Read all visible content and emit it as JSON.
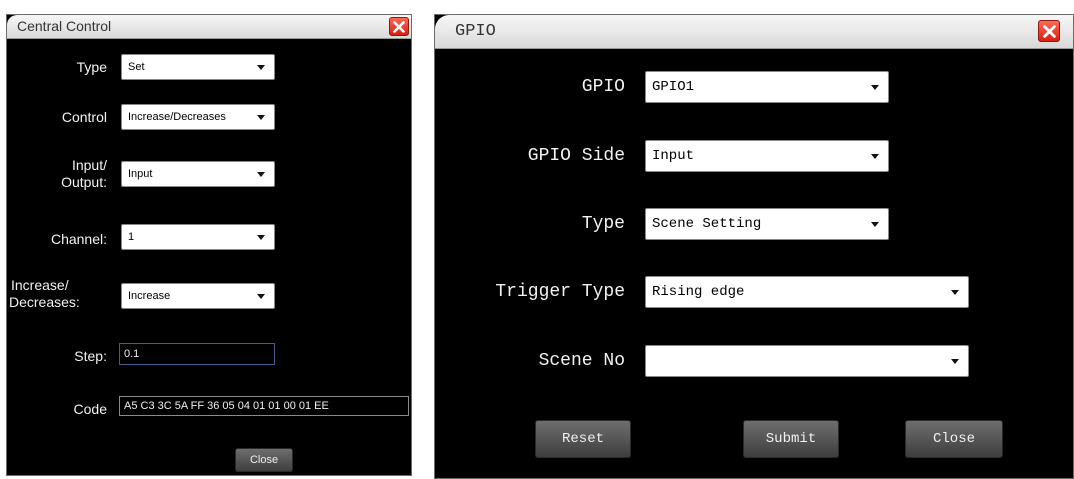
{
  "central_control": {
    "title": "Central Control",
    "type": {
      "label": "Type",
      "value": "Set"
    },
    "control": {
      "label": "Control",
      "value": "Increase/Decreases"
    },
    "input_output": {
      "label_line1": "Input/",
      "label_line2": "Output:",
      "value": "Input"
    },
    "channel": {
      "label": "Channel:",
      "value": "1"
    },
    "increase_decreases": {
      "label_line1": "Increase/",
      "label_line2": "Decreases:",
      "value": "Increase"
    },
    "step": {
      "label": "Step:",
      "value": "0.1"
    },
    "code": {
      "label": "Code",
      "value": "A5 C3 3C 5A FF 36 05 04 01 01 00 01 EE"
    },
    "close_label": "Close"
  },
  "gpio": {
    "title": "GPIO",
    "gpio": {
      "label": "GPIO",
      "value": "GPIO1"
    },
    "gpio_side": {
      "label": "GPIO Side",
      "value": "Input"
    },
    "type": {
      "label": "Type",
      "value": "Scene Setting"
    },
    "trigger_type": {
      "label": "Trigger Type",
      "value": "Rising edge"
    },
    "scene_no": {
      "label": "Scene No",
      "value": ""
    },
    "reset_label": "Reset",
    "submit_label": "Submit",
    "close_label": "Close"
  },
  "colors": {
    "close_x": "#e0301e",
    "dialog_bg": "#000000",
    "titlebar": "#e4e4e4",
    "step_border": "#3f5f8f"
  },
  "icons": {
    "window_close": "close-icon",
    "dropdown": "chevron-down-icon"
  }
}
